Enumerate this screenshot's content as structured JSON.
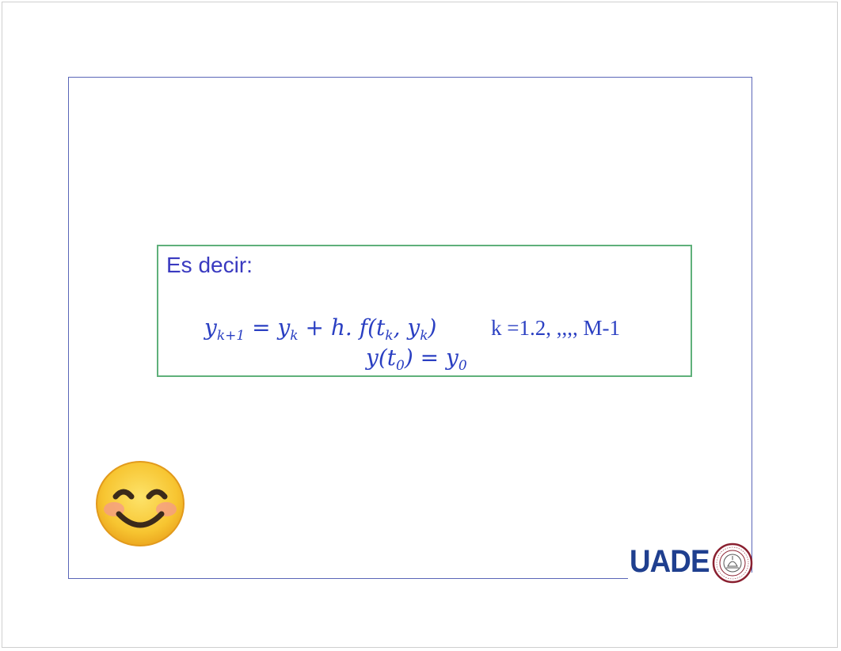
{
  "slide": {
    "heading": "Es decir:",
    "formula": {
      "recurrence": {
        "lhs_base": "y",
        "lhs_sub": "k+1",
        "equals": " = ",
        "rhs_base": "y",
        "rhs_sub": "k",
        "rhs_rest_a": " + h. f(t",
        "rhs_t_sub": "k",
        "rhs_rest_b": ", y",
        "rhs_y_sub": "k",
        "rhs_close": ")"
      },
      "condition": "k =1.2, ,,,, M-1",
      "initial": {
        "lhs_a": "y(t",
        "lhs_sub": "0",
        "lhs_close": ")",
        "equals": " = ",
        "rhs_base": "y",
        "rhs_sub": "0"
      }
    }
  },
  "logo": {
    "text": "UADE",
    "seal_text": "UNIVERSIDAD ARGENTINA DE LA EMPRESA"
  },
  "colors": {
    "heading": "#3a3ac0",
    "formula": "#2a3fc2",
    "box_border": "#5fb07a",
    "frame_border": "#5a66b8",
    "logo": "#1f3f8f",
    "seal": "#8a2030"
  },
  "icons": {
    "emoji": "smiling-face-icon"
  }
}
